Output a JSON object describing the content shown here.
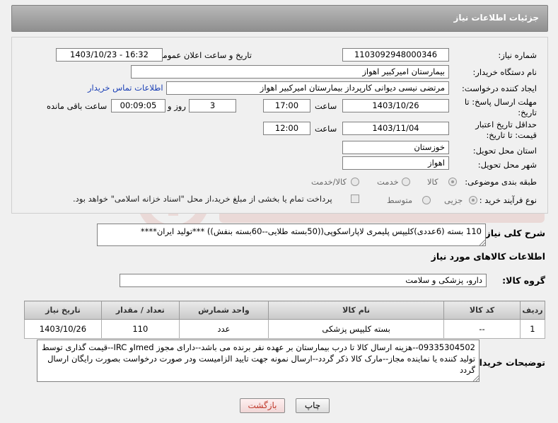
{
  "header": {
    "title": "جزئیات اطلاعات نیاز"
  },
  "labels": {
    "need_number": "شماره نیاز:",
    "announce_datetime": "تاریخ و ساعت اعلان عمومی:",
    "buyer_org": "نام دستگاه خریدار:",
    "requester": "ایجاد کننده درخواست:",
    "reply_deadline": "مهلت ارسال پاسخ: تا تاریخ:",
    "price_validity": "حداقل تاریخ اعتبار قیمت: تا تاریخ:",
    "time": "ساعت",
    "day_and": "روز و",
    "remaining": "ساعت باقی مانده",
    "province": "استان محل تحویل:",
    "city": "شهر محل تحویل:",
    "category": "طبقه بندی موضوعی:",
    "process_type": "نوع فرآیند خرید :",
    "general_desc": "شرح کلی نیاز:",
    "items_info": "اطلاعات کالاهای مورد نیاز",
    "goods_group": "گروه کالا:",
    "buyer_notes": "توضیحات خریدار:"
  },
  "fields": {
    "need_number": "1103092948000346",
    "announce_datetime": "1403/10/23 - 16:32",
    "buyer_org": "بیمارستان امیرکبیر اهواز",
    "requester": "مرتضی نیسی دیوانی کارپرداز بیمارستان امیرکبیر اهواز",
    "contact_link": "اطلاعات تماس خریدار",
    "reply_date": "1403/10/26",
    "reply_time": "17:00",
    "reply_days": "3",
    "reply_remaining": "00:09:05",
    "validity_date": "1403/11/04",
    "validity_time": "12:00",
    "province": "خوزستان",
    "city": "اهواز"
  },
  "category_options": {
    "goods": "کالا",
    "service": "خدمت",
    "goods_service": "کالا/خدمت"
  },
  "process_options": {
    "partial": "جزیی",
    "medium": "متوسط",
    "treasury_note": "پرداخت تمام یا بخشی از مبلغ خرید،از محل \"اسناد خزانه اسلامی\" خواهد بود."
  },
  "general_desc": "110 بسته (6عددی)کلیپس پلیمری لاپاراسکوپی((50بسته طلایی--60بسته بنفش)) ***تولید ایران****",
  "goods_group": "دارو، پزشکی و سلامت",
  "table": {
    "headers": [
      "ردیف",
      "کد کالا",
      "نام کالا",
      "واحد شمارش",
      "تعداد / مقدار",
      "تاریخ نیاز"
    ],
    "rows": [
      [
        "1",
        "--",
        "بسته کلیپس پزشکی",
        "عدد",
        "110",
        "1403/10/26"
      ]
    ]
  },
  "buyer_notes": "09335304502--هزینه ارسال کالا تا درب بیمارستان بر عهده نفر برنده می باشد--دارای مجوز Imedو IRC--قیمت گذاری توسط تولید کننده یا نماینده مجاز--مارک کالا ذکر گردد--ارسال نمونه جهت تایید الزامیست ودر صورت درخواست بصورت رایگان ارسال گردد",
  "buttons": {
    "print": "چاپ",
    "back": "بازگشت"
  },
  "colors": {
    "link": "#1a3fb5",
    "back_button_text": "#c0392b"
  }
}
